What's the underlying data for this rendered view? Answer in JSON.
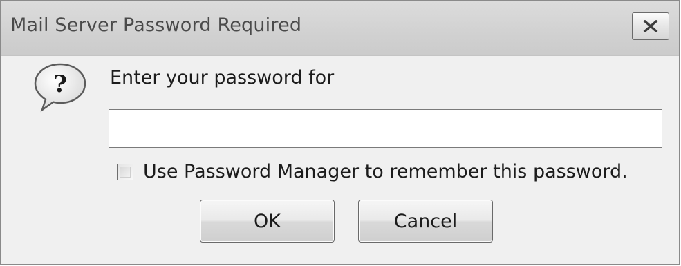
{
  "dialog": {
    "title": "Mail Server Password Required",
    "close_icon": "close-icon",
    "message_icon": "question-icon",
    "prompt": "Enter your password for",
    "password_value": "",
    "remember_checkbox": {
      "label": "Use Password Manager to remember this password.",
      "checked": false
    },
    "buttons": {
      "ok_label": "OK",
      "cancel_label": "Cancel"
    }
  }
}
